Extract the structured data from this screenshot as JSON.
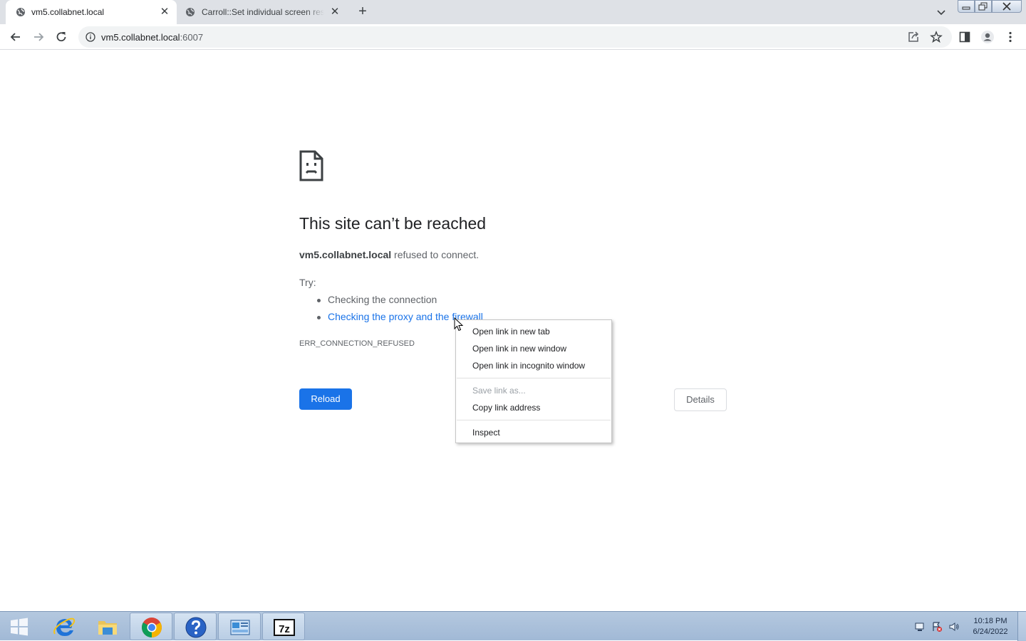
{
  "browser": {
    "tabs": [
      {
        "title": "vm5.collabnet.local",
        "active": true,
        "favicon": "globe-icon"
      },
      {
        "title": "Carroll::Set individual screen resolution",
        "active": false,
        "favicon": "globe-icon"
      }
    ],
    "new_tab_label": "+",
    "address": {
      "host": "vm5.collabnet.local",
      "port": ":6007"
    },
    "colors": {
      "tab_strip": "#dee1e6",
      "omnibox": "#f1f3f4",
      "accent": "#1a73e8"
    }
  },
  "error_page": {
    "icon": "sad-page-icon",
    "title": "This site can’t be reached",
    "host": "vm5.collabnet.local",
    "message": " refused to connect.",
    "try_label": "Try:",
    "suggestions": [
      {
        "text": "Checking the connection",
        "link": false
      },
      {
        "text": "Checking the proxy and the firewall",
        "link": true
      }
    ],
    "error_code": "ERR_CONNECTION_REFUSED",
    "reload_label": "Reload",
    "details_label": "Details"
  },
  "context_menu": {
    "items": [
      {
        "label": "Open link in new tab",
        "enabled": true
      },
      {
        "label": "Open link in new window",
        "enabled": true
      },
      {
        "label": "Open link in incognito window",
        "enabled": true
      },
      {
        "label": "Save link as...",
        "enabled": false
      },
      {
        "label": "Copy link address",
        "enabled": true
      },
      {
        "label": "Inspect",
        "enabled": true
      }
    ]
  },
  "taskbar": {
    "apps": [
      "internet-explorer-icon",
      "file-explorer-icon",
      "chrome-icon",
      "help-icon",
      "control-panel-icon",
      "7zip-icon"
    ],
    "seven_zip_label": "7z",
    "clock": {
      "time": "10:18 PM",
      "date": "6/24/2022"
    }
  }
}
